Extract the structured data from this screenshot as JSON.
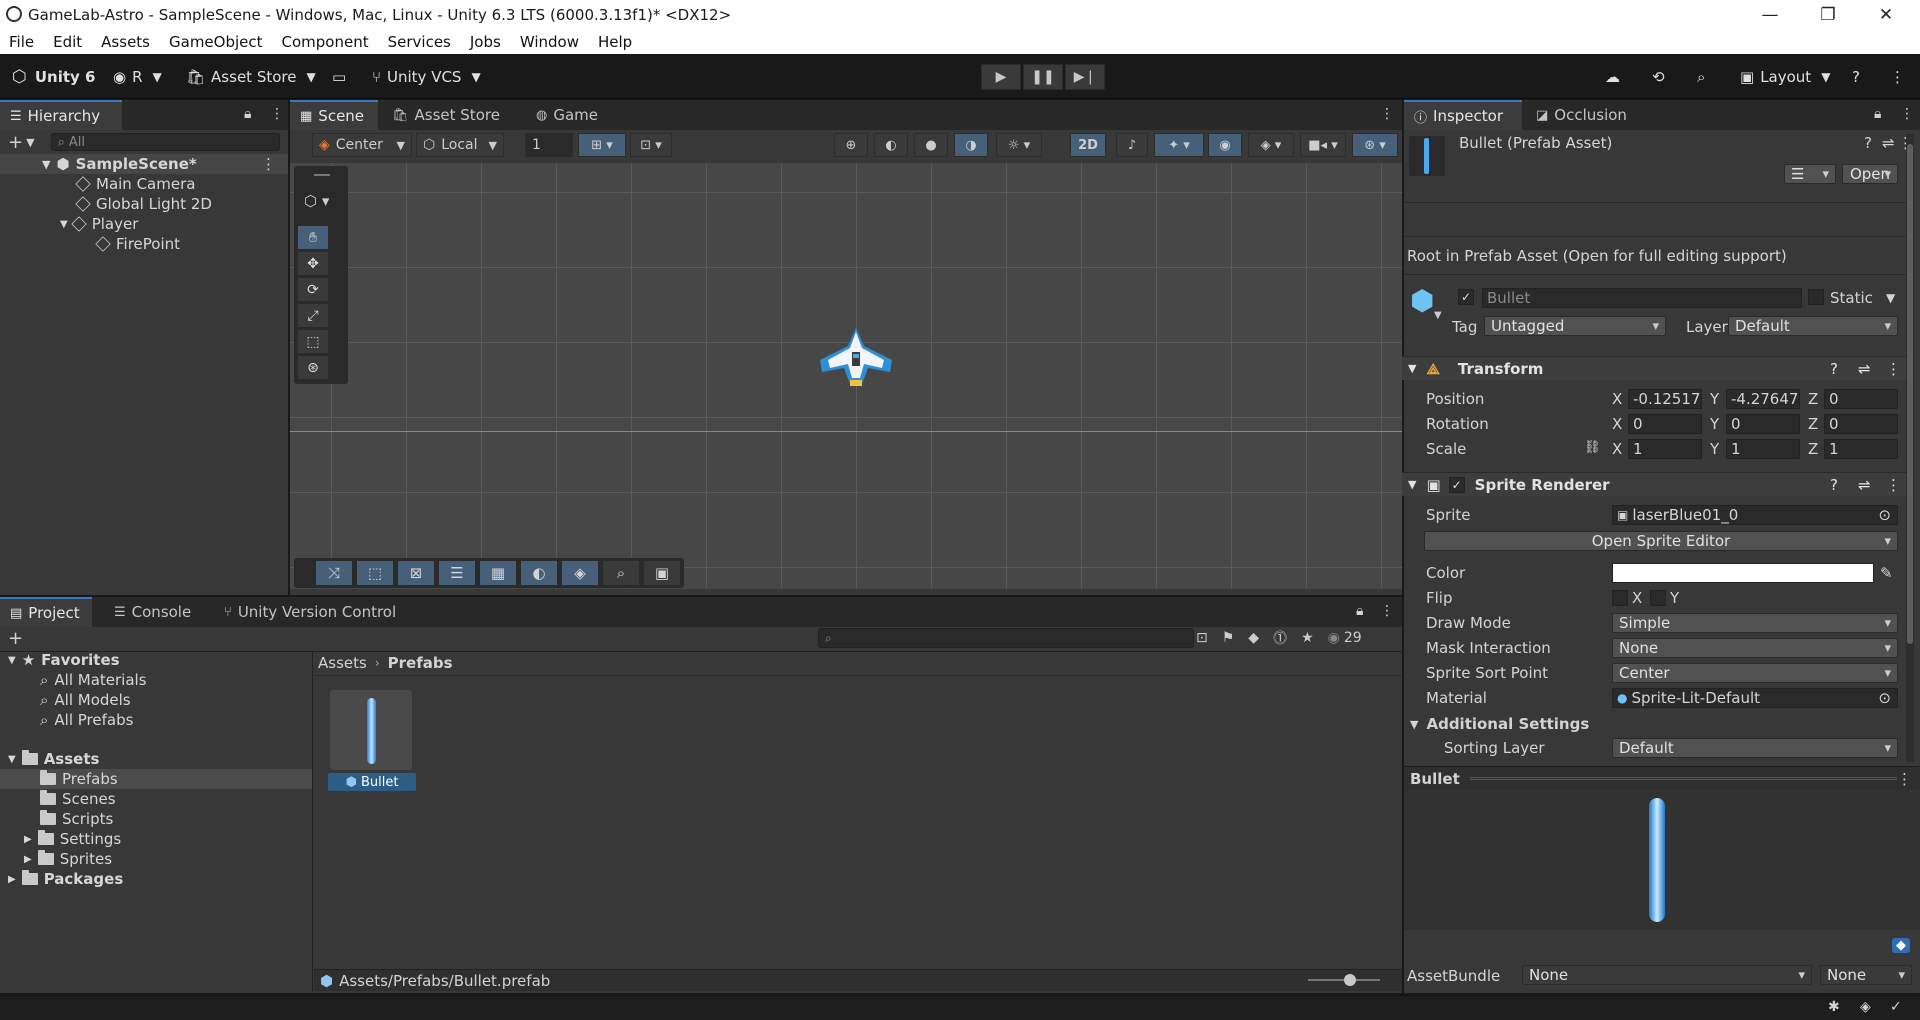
{
  "window": {
    "title": "GameLab-Astro - SampleScene - Windows, Mac, Linux - Unity 6.3 LTS (6000.3.13f1)* <DX12>"
  },
  "menu": [
    "File",
    "Edit",
    "Assets",
    "GameObject",
    "Component",
    "Services",
    "Jobs",
    "Window",
    "Help"
  ],
  "toolbar": {
    "unity_label": "Unity 6",
    "account_label": "R",
    "asset_store_label": "Asset Store",
    "vcs_label": "Unity VCS",
    "layout_label": "Layout"
  },
  "hierarchy": {
    "tab": "Hierarchy",
    "search_placeholder": "All",
    "scene_name": "SampleScene*",
    "items": [
      "Main Camera",
      "Global Light 2D",
      "Player",
      "FirePoint"
    ]
  },
  "scene": {
    "tabs": [
      "Scene",
      "Asset Store",
      "Game"
    ],
    "pivot": "Center",
    "space": "Local",
    "grid_value": "1",
    "mode_2d": "2D"
  },
  "inspector": {
    "tabs": [
      "Inspector",
      "Occlusion"
    ],
    "asset_title": "Bullet (Prefab Asset)",
    "open_label": "Open",
    "root_note": "Root in Prefab Asset (Open for full editing support)",
    "object_name": "Bullet",
    "static_label": "Static",
    "tag_label": "Tag",
    "tag_value": "Untagged",
    "layer_label": "Layer",
    "layer_value": "Default",
    "transform": {
      "title": "Transform",
      "position_label": "Position",
      "rotation_label": "Rotation",
      "scale_label": "Scale",
      "axis_x": "X",
      "axis_y": "Y",
      "axis_z": "Z",
      "position": [
        "-0.12517",
        "-4.27647",
        "0"
      ],
      "rotation": [
        "0",
        "0",
        "0"
      ],
      "scale": [
        "1",
        "1",
        "1"
      ]
    },
    "sprite_renderer": {
      "title": "Sprite Renderer",
      "sprite_label": "Sprite",
      "sprite_value": "laserBlue01_0",
      "open_editor": "Open Sprite Editor",
      "color_label": "Color",
      "flip_label": "Flip",
      "flip_x": "X",
      "flip_y": "Y",
      "draw_mode_label": "Draw Mode",
      "draw_mode_value": "Simple",
      "mask_label": "Mask Interaction",
      "mask_value": "None",
      "sort_point_label": "Sprite Sort Point",
      "sort_point_value": "Center",
      "material_label": "Material",
      "material_value": "Sprite-Lit-Default",
      "additional_label": "Additional Settings",
      "sorting_layer_label": "Sorting Layer",
      "sorting_layer_value": "Default"
    },
    "preview_title": "Bullet",
    "assetbundle_label": "AssetBundle",
    "assetbundle_value": "None",
    "assetbundle_variant": "None"
  },
  "project": {
    "tabs": [
      "Project",
      "Console",
      "Unity Version Control"
    ],
    "hidden_count": "29",
    "favorites_label": "Favorites",
    "favorites": [
      "All Materials",
      "All Models",
      "All Prefabs"
    ],
    "assets_label": "Assets",
    "asset_folders": [
      "Prefabs",
      "Scenes",
      "Scripts",
      "Settings",
      "Sprites"
    ],
    "packages_label": "Packages",
    "breadcrumb_root": "Assets",
    "breadcrumb_current": "Prefabs",
    "items": [
      "Bullet"
    ],
    "footer_path": "Assets/Prefabs/Bullet.prefab"
  },
  "colors": {
    "accent": "#3a79bb",
    "selection": "#2c5d87",
    "panel": "#383838"
  }
}
